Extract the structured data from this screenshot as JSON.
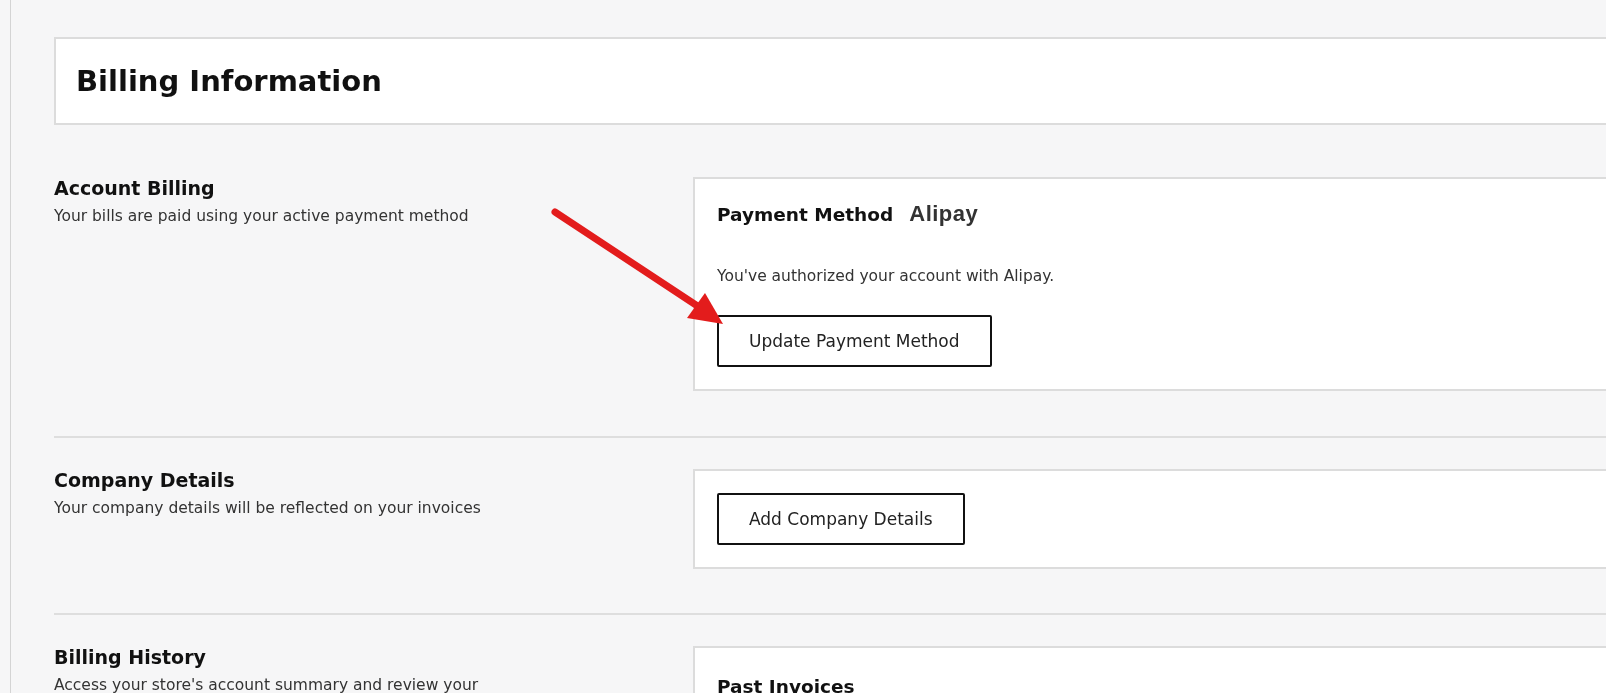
{
  "page": {
    "title": "Billing Information"
  },
  "sections": [
    {
      "kind": "payment",
      "heading": "Account Billing",
      "description": "Your bills are paid using your active payment method",
      "card": {
        "title": "Payment Method",
        "logo": "Alipay",
        "text": "You've authorized your account with Alipay.",
        "button": "Update Payment Method"
      }
    },
    {
      "kind": "action",
      "heading": "Company Details",
      "description": "Your company details will be reflected on your invoices",
      "card": {
        "button": "Add Company Details"
      }
    },
    {
      "kind": "list",
      "heading": "Billing History",
      "description": "Access your store's account summary and review your",
      "card": {
        "title": "Past Invoices"
      }
    }
  ]
}
